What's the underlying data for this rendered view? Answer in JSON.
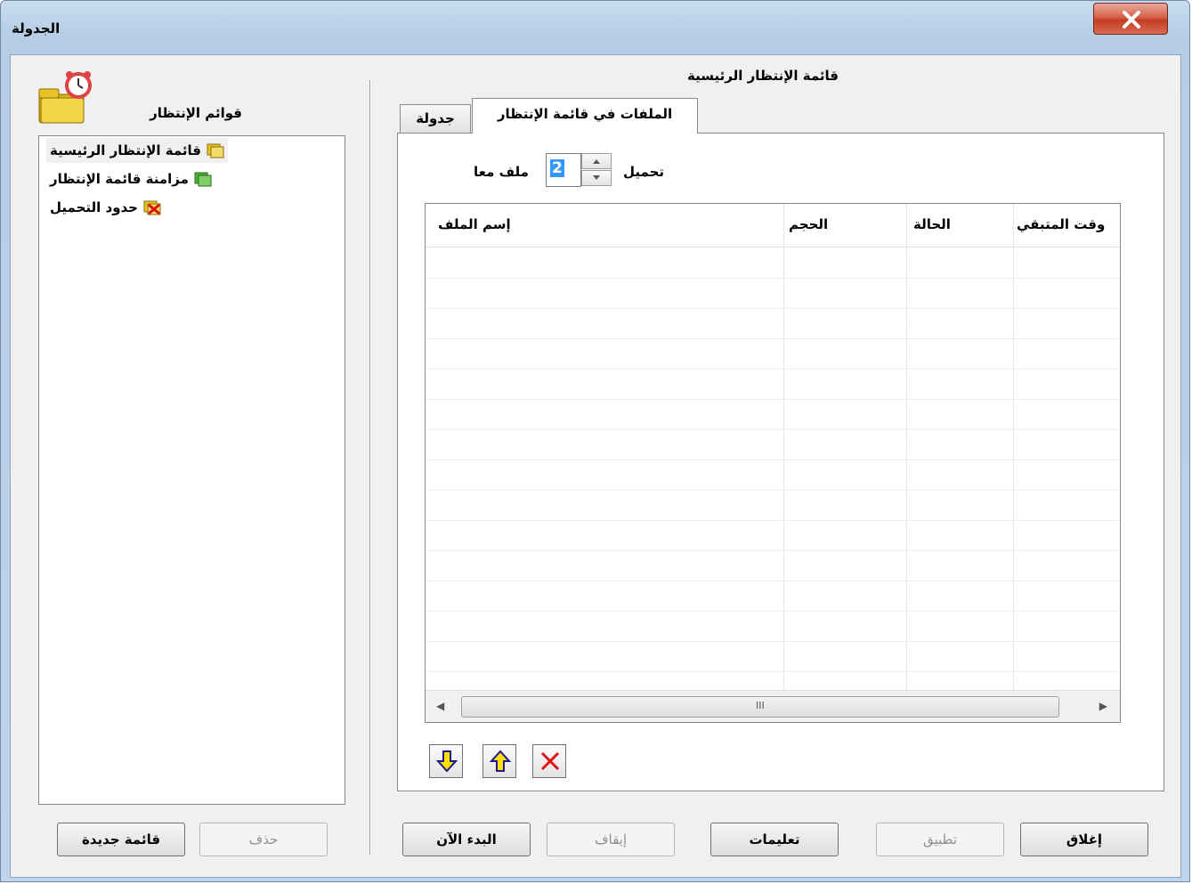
{
  "window": {
    "title": "الجدولة"
  },
  "left": {
    "label": "قوائم الإنتظار",
    "items": [
      {
        "label": "قائمة الإنتظار الرئيسية",
        "icon": "queue-folder-yellow-icon"
      },
      {
        "label": "مزامنة قائمة الإنتظار",
        "icon": "queue-folder-green-icon"
      },
      {
        "label": "حدود التحميل",
        "icon": "download-limits-x-icon"
      }
    ],
    "new_list_button": "قائمة جديدة",
    "delete_button": "حذف"
  },
  "main": {
    "title": "قائمة الإنتظار الرئيسية",
    "tabs": [
      {
        "label": "الملفات في قائمة الإنتظار",
        "active": true
      },
      {
        "label": "جدولة",
        "active": false
      }
    ],
    "download_label": "تحميل",
    "concurrent_value": "2",
    "files_together_label": "ملف معا",
    "columns": [
      "إسم الملف",
      "الحجم",
      "الحالة",
      "وقت المتبقي"
    ],
    "hscroll_grip": "III"
  },
  "footer": {
    "start_now": "البدء الآن",
    "stop": "إيقاف",
    "help": "تعليمات",
    "apply": "تطبيق",
    "close": "إغلاق"
  },
  "colors": {
    "titlebar": "#bfd4ea",
    "close_button": "#c43d25",
    "selection": "#3399ff"
  }
}
